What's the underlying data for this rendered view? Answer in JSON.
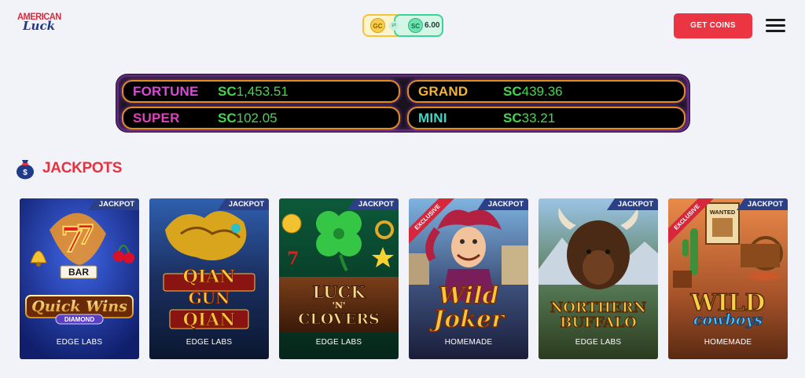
{
  "header": {
    "logo_top": "AMERICAN",
    "logo_bottom": "Luck",
    "currency": {
      "gc_label": "GC",
      "sc_label": "SC",
      "sc_amount": "6.00"
    },
    "get_coins_label": "GET COINS"
  },
  "ticker": {
    "fortune": {
      "name": "FORTUNE",
      "currency": "SC",
      "amount": "1,453.51",
      "color": "#d64bd8"
    },
    "grand": {
      "name": "GRAND",
      "currency": "SC",
      "amount": "439.36",
      "color": "#f2b53a"
    },
    "super": {
      "name": "SUPER",
      "currency": "SC",
      "amount": "102.05",
      "color": "#e23fbf"
    },
    "mini": {
      "name": "MINI",
      "currency": "SC",
      "amount": "33.21",
      "color": "#3fd6c5"
    }
  },
  "section": {
    "title": "JACKPOTS"
  },
  "games": [
    {
      "title_lines": [
        "Quick Wins",
        "DIAMOND"
      ],
      "studio": "EDGE LABS",
      "tag": "JACKPOT"
    },
    {
      "title_lines": [
        "QIAN",
        "GUN",
        "QIAN"
      ],
      "studio": "EDGE LABS",
      "tag": "JACKPOT"
    },
    {
      "title_lines": [
        "LUCK",
        "'N'",
        "CLOVERS"
      ],
      "studio": "EDGE LABS",
      "tag": "JACKPOT"
    },
    {
      "title_lines": [
        "Wild",
        "Joker"
      ],
      "studio": "HOMEMADE",
      "tag": "JACKPOT",
      "ribbon": "EXCLUSIVE"
    },
    {
      "title_lines": [
        "NORTHERN",
        "BUFFALO"
      ],
      "studio": "EDGE LABS",
      "tag": "JACKPOT"
    },
    {
      "title_lines": [
        "WILD",
        "cowboys"
      ],
      "studio": "HOMEMADE",
      "tag": "JACKPOT",
      "ribbon": "EXCLUSIVE",
      "sign": "WANTED"
    }
  ],
  "colors": {
    "accent_red": "#ec3543",
    "brand_blue": "#1f3a8a",
    "amount_green": "#46d64e",
    "tag_blue": "#2c4087"
  }
}
